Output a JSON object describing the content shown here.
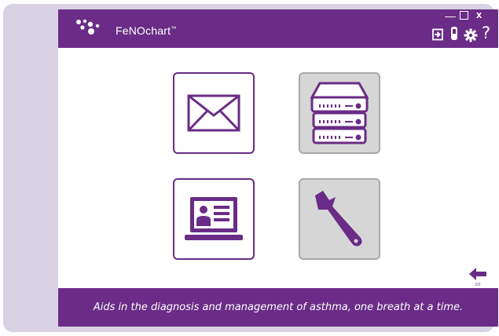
{
  "app": {
    "title": "FeNOchart",
    "trademark": "™"
  },
  "window_controls": {
    "minimize": "—",
    "close": "x"
  },
  "toolbar": {
    "help_label": "?",
    "icons": [
      "logout-icon",
      "device-icon",
      "settings-icon",
      "help-icon"
    ]
  },
  "tiles": [
    {
      "name": "message",
      "icon": "envelope-icon",
      "state": "enabled"
    },
    {
      "name": "server",
      "icon": "server-icon",
      "state": "disabled"
    },
    {
      "name": "patient-profile",
      "icon": "laptop-profile-icon",
      "state": "enabled"
    },
    {
      "name": "tools",
      "icon": "wrench-icon",
      "state": "disabled"
    }
  ],
  "pagination": {
    "indicator": "2/2"
  },
  "footer": {
    "tagline": "Aids in the diagnosis and management of asthma, one breath at a time."
  },
  "colors": {
    "brand_purple": "#6a2c86",
    "frame": "#d9d1e4",
    "disabled_tile": "#d6d6d6"
  }
}
